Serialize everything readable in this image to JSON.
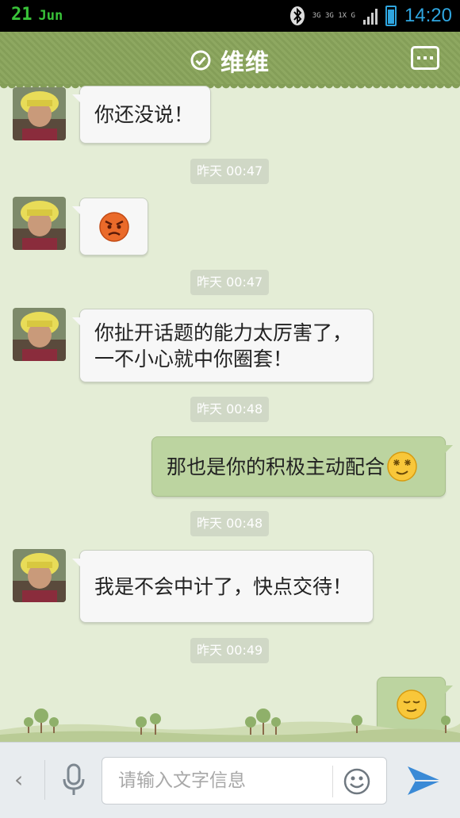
{
  "status_bar": {
    "date_day": "21",
    "date_month": "Jun",
    "network_text": "3G 3G 1X G",
    "time": "14:20"
  },
  "header": {
    "title": "维维",
    "icons": [
      "check-circle-icon",
      "more-menu-icon"
    ]
  },
  "messages": [
    {
      "type": "text",
      "from": "contact",
      "text": "你还没说！"
    },
    {
      "type": "timestamp",
      "text": "昨天 00:47"
    },
    {
      "type": "emoji",
      "from": "contact",
      "icon": "angry-face-icon"
    },
    {
      "type": "timestamp",
      "text": "昨天 00:47"
    },
    {
      "type": "text",
      "from": "contact",
      "text": "你扯开话题的能力太厉害了，一不小心就中你圈套！"
    },
    {
      "type": "timestamp",
      "text": "昨天 00:48"
    },
    {
      "type": "text",
      "from": "me",
      "text": "那也是你的积极主动配合",
      "trailing_icon": "shy-smile-face-icon"
    },
    {
      "type": "timestamp",
      "text": "昨天 00:48"
    },
    {
      "type": "text",
      "from": "contact",
      "text": "我是不会中计了，快点交待！"
    },
    {
      "type": "timestamp",
      "text": "昨天 00:49"
    },
    {
      "type": "emoji",
      "from": "me",
      "icon": "content-smile-face-icon"
    }
  ],
  "input_bar": {
    "back_label": "‹",
    "placeholder": "请输入文字信息",
    "icons": [
      "back-arrow-icon",
      "microphone-icon",
      "emoji-icon",
      "send-icon"
    ]
  },
  "colors": {
    "header_green": "#8ea861",
    "chat_background": "#e4edd6",
    "outgoing_bubble": "#bcd4a0",
    "incoming_bubble": "#f7f7f7",
    "time_accent": "#2fa6e0"
  }
}
